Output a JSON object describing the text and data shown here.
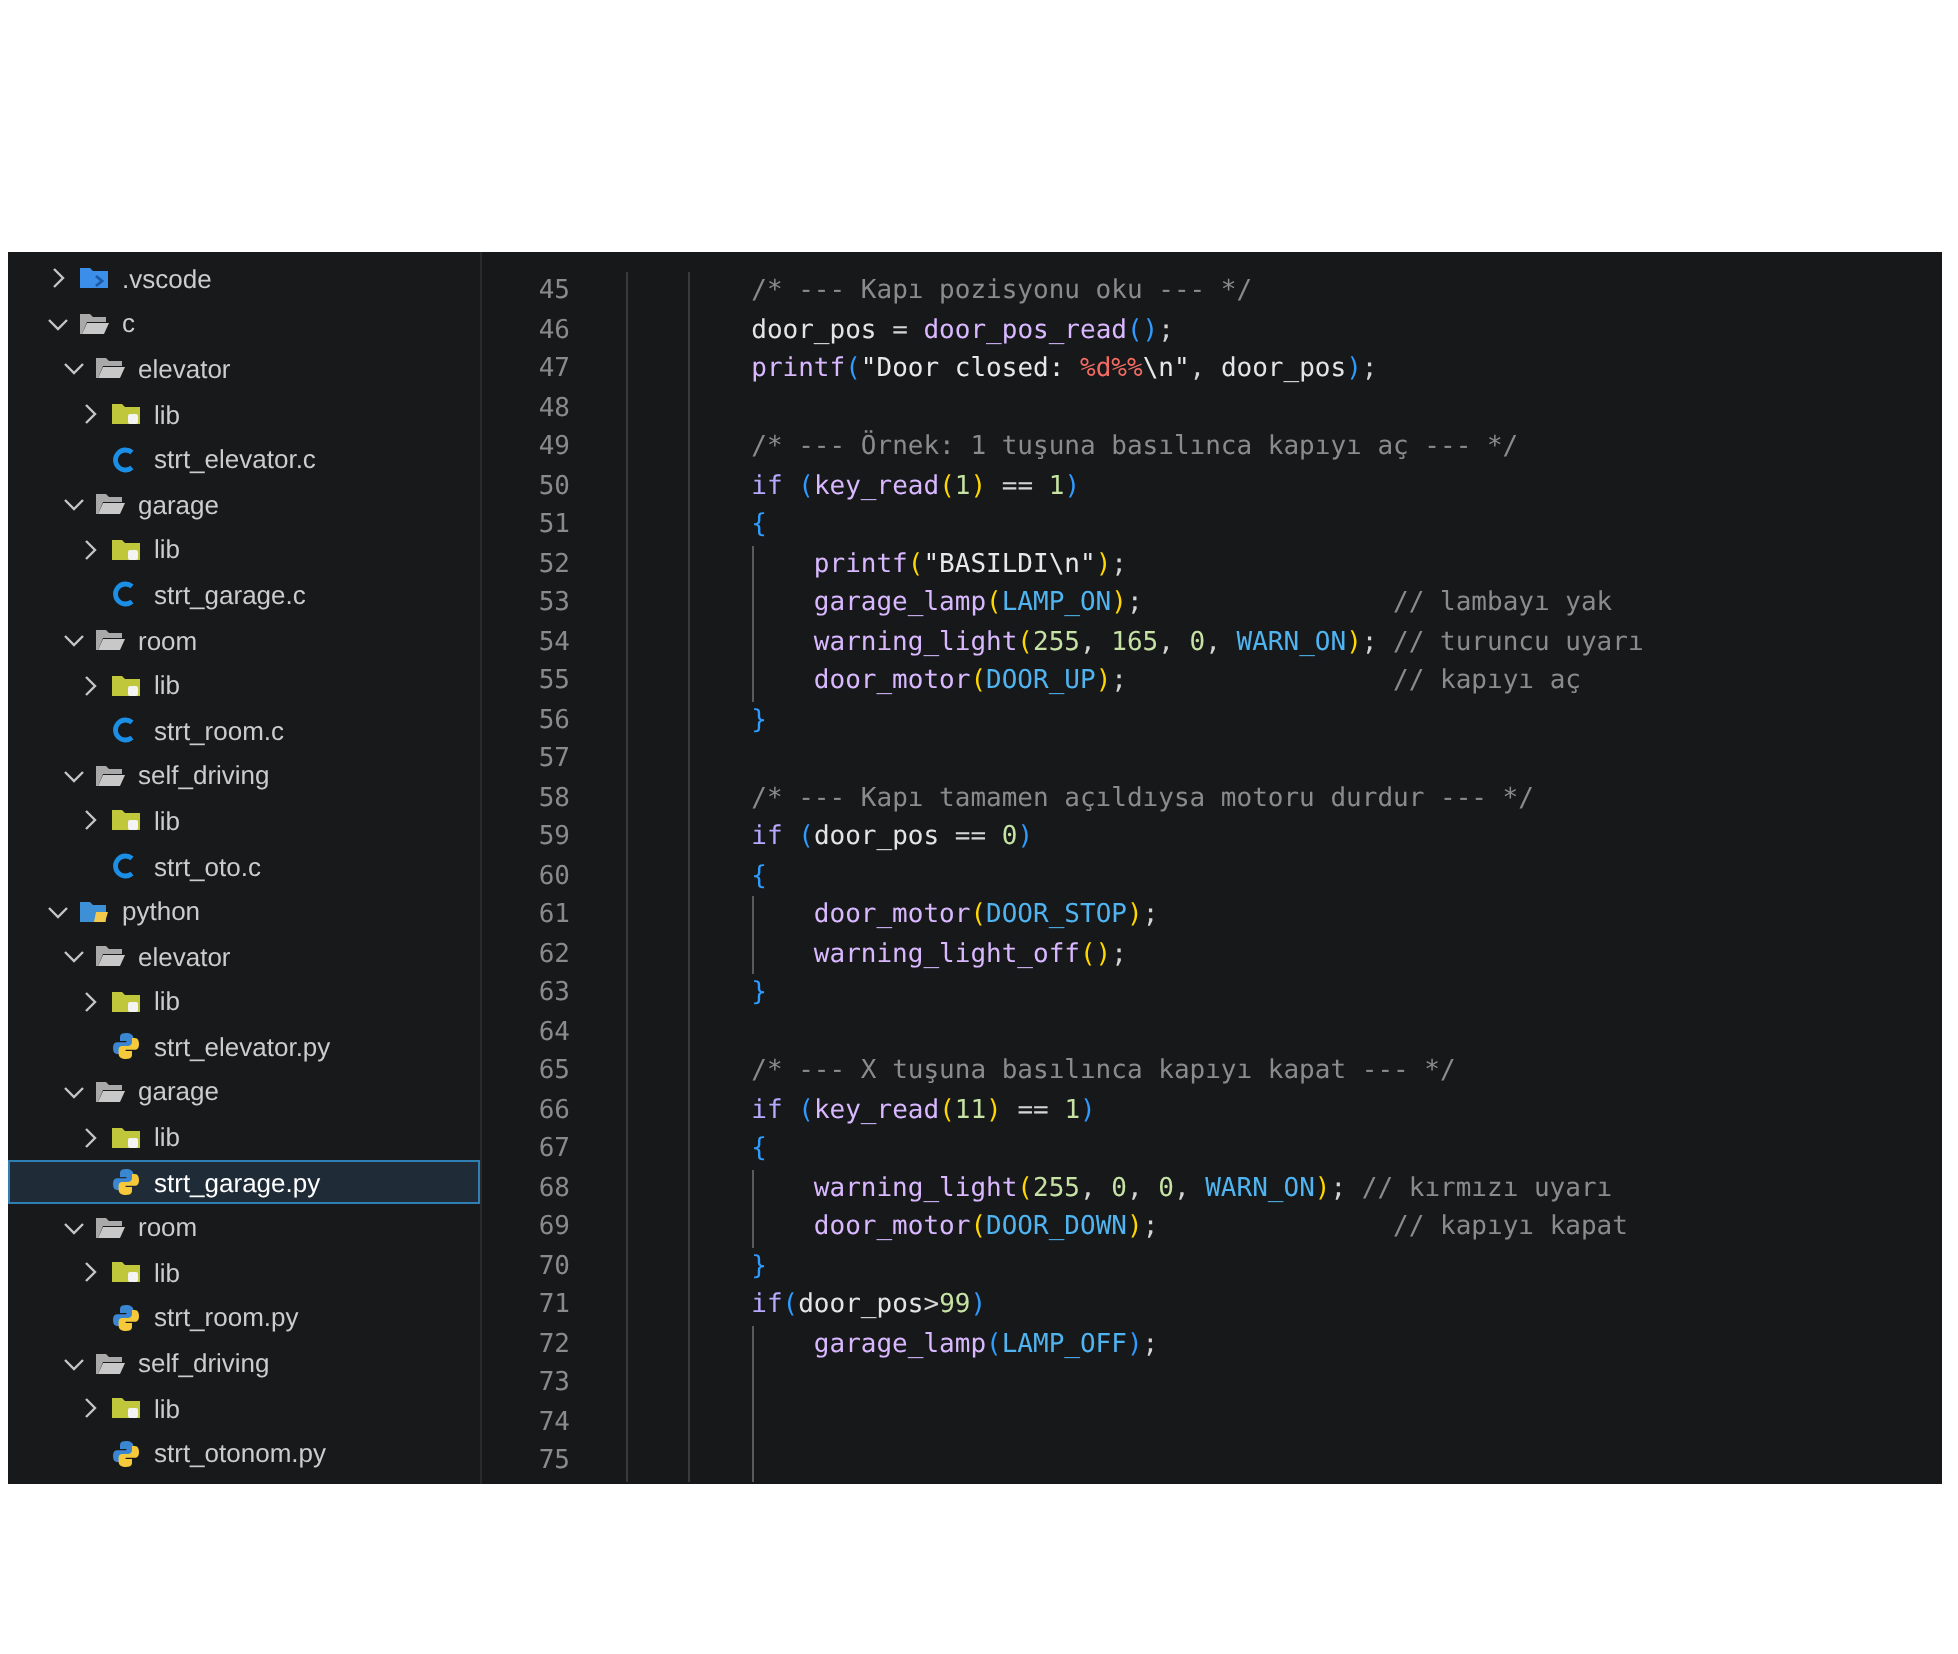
{
  "sidebar": {
    "items": [
      {
        "label": ".vscode",
        "kind": "vscode-folder",
        "expanded": false,
        "selected": false
      },
      {
        "label": "c",
        "kind": "folder",
        "expanded": true,
        "selected": false,
        "children": [
          {
            "label": "elevator",
            "kind": "folder",
            "expanded": true,
            "selected": false,
            "children": [
              {
                "label": "lib",
                "kind": "lib-folder",
                "expanded": false,
                "selected": false
              },
              {
                "label": "strt_elevator.c",
                "kind": "c-file",
                "selected": false
              }
            ]
          },
          {
            "label": "garage",
            "kind": "folder",
            "expanded": true,
            "selected": false,
            "children": [
              {
                "label": "lib",
                "kind": "lib-folder",
                "expanded": false,
                "selected": false
              },
              {
                "label": "strt_garage.c",
                "kind": "c-file",
                "selected": false
              }
            ]
          },
          {
            "label": "room",
            "kind": "folder",
            "expanded": true,
            "selected": false,
            "children": [
              {
                "label": "lib",
                "kind": "lib-folder",
                "expanded": false,
                "selected": false
              },
              {
                "label": "strt_room.c",
                "kind": "c-file",
                "selected": false
              }
            ]
          },
          {
            "label": "self_driving",
            "kind": "folder",
            "expanded": true,
            "selected": false,
            "children": [
              {
                "label": "lib",
                "kind": "lib-folder",
                "expanded": false,
                "selected": false
              },
              {
                "label": "strt_oto.c",
                "kind": "c-file",
                "selected": false
              }
            ]
          }
        ]
      },
      {
        "label": "python",
        "kind": "python-folder",
        "expanded": true,
        "selected": false,
        "children": [
          {
            "label": "elevator",
            "kind": "folder",
            "expanded": true,
            "selected": false,
            "children": [
              {
                "label": "lib",
                "kind": "lib-folder",
                "expanded": false,
                "selected": false
              },
              {
                "label": "strt_elevator.py",
                "kind": "py-file",
                "selected": false
              }
            ]
          },
          {
            "label": "garage",
            "kind": "folder",
            "expanded": true,
            "selected": false,
            "children": [
              {
                "label": "lib",
                "kind": "lib-folder",
                "expanded": false,
                "selected": false
              },
              {
                "label": "strt_garage.py",
                "kind": "py-file",
                "selected": true
              }
            ]
          },
          {
            "label": "room",
            "kind": "folder",
            "expanded": true,
            "selected": false,
            "children": [
              {
                "label": "lib",
                "kind": "lib-folder",
                "expanded": false,
                "selected": false
              },
              {
                "label": "strt_room.py",
                "kind": "py-file",
                "selected": false
              }
            ]
          },
          {
            "label": "self_driving",
            "kind": "folder",
            "expanded": true,
            "selected": false,
            "children": [
              {
                "label": "lib",
                "kind": "lib-folder",
                "expanded": false,
                "selected": false
              },
              {
                "label": "strt_otonom.py",
                "kind": "py-file",
                "selected": false
              }
            ]
          }
        ]
      }
    ]
  },
  "editor": {
    "lines": [
      {
        "number": "45",
        "tokens": [
          {
            "kind": "comment",
            "text": "        /* --- Kapı pozisyonu oku --- */"
          }
        ]
      },
      {
        "number": "46",
        "tokens": [
          {
            "kind": "var",
            "text": "        door_pos"
          },
          {
            "kind": "op",
            "text": " = "
          },
          {
            "kind": "fn",
            "text": "door_pos_read"
          },
          {
            "kind": "p1",
            "text": "()"
          },
          {
            "kind": "punc",
            "text": ";"
          }
        ]
      },
      {
        "number": "47",
        "tokens": [
          {
            "kind": "fn",
            "text": "        printf"
          },
          {
            "kind": "p1",
            "text": "("
          },
          {
            "kind": "str",
            "text": "\"Door closed: "
          },
          {
            "kind": "fmt",
            "text": "%d%%"
          },
          {
            "kind": "esc",
            "text": "\\n"
          },
          {
            "kind": "str",
            "text": "\""
          },
          {
            "kind": "punc",
            "text": ", "
          },
          {
            "kind": "var",
            "text": "door_pos"
          },
          {
            "kind": "p1",
            "text": ")"
          },
          {
            "kind": "punc",
            "text": ";"
          }
        ]
      },
      {
        "number": "48"
      },
      {
        "number": "49",
        "tokens": [
          {
            "kind": "comment",
            "text": "        /* --- Örnek: 1 tuşuna basılınca kapıyı aç --- */"
          }
        ]
      },
      {
        "number": "50",
        "tokens": [
          {
            "kind": "kw",
            "text": "        if "
          },
          {
            "kind": "p1",
            "text": "("
          },
          {
            "kind": "fn",
            "text": "key_read"
          },
          {
            "kind": "p2",
            "text": "("
          },
          {
            "kind": "num",
            "text": "1"
          },
          {
            "kind": "p2",
            "text": ")"
          },
          {
            "kind": "op",
            "text": " == "
          },
          {
            "kind": "num",
            "text": "1"
          },
          {
            "kind": "p1",
            "text": ")"
          }
        ]
      },
      {
        "number": "51",
        "tokens": [
          {
            "kind": "p1",
            "text": "        {"
          }
        ]
      },
      {
        "number": "52",
        "tokens": [
          {
            "kind": "fn",
            "text": "            printf"
          },
          {
            "kind": "p2",
            "text": "("
          },
          {
            "kind": "str",
            "text": "\"BASILDI"
          },
          {
            "kind": "esc",
            "text": "\\n"
          },
          {
            "kind": "str",
            "text": "\""
          },
          {
            "kind": "p2",
            "text": ")"
          },
          {
            "kind": "punc",
            "text": ";"
          }
        ]
      },
      {
        "number": "53",
        "tokens": [
          {
            "kind": "fn",
            "text": "            garage_lamp"
          },
          {
            "kind": "p2",
            "text": "("
          },
          {
            "kind": "const",
            "text": "LAMP_ON"
          },
          {
            "kind": "p2",
            "text": ")"
          },
          {
            "kind": "punc",
            "text": ";                "
          },
          {
            "kind": "comment",
            "text": "// lambayı yak"
          }
        ]
      },
      {
        "number": "54",
        "tokens": [
          {
            "kind": "fn",
            "text": "            warning_light"
          },
          {
            "kind": "p2",
            "text": "("
          },
          {
            "kind": "num",
            "text": "255"
          },
          {
            "kind": "punc",
            "text": ", "
          },
          {
            "kind": "num",
            "text": "165"
          },
          {
            "kind": "punc",
            "text": ", "
          },
          {
            "kind": "num",
            "text": "0"
          },
          {
            "kind": "punc",
            "text": ", "
          },
          {
            "kind": "const",
            "text": "WARN_ON"
          },
          {
            "kind": "p2",
            "text": ")"
          },
          {
            "kind": "punc",
            "text": "; "
          },
          {
            "kind": "comment",
            "text": "// turuncu uyarı"
          }
        ]
      },
      {
        "number": "55",
        "tokens": [
          {
            "kind": "fn",
            "text": "            door_motor"
          },
          {
            "kind": "p2",
            "text": "("
          },
          {
            "kind": "const",
            "text": "DOOR_UP"
          },
          {
            "kind": "p2",
            "text": ")"
          },
          {
            "kind": "punc",
            "text": ";                 "
          },
          {
            "kind": "comment",
            "text": "// kapıyı aç"
          }
        ]
      },
      {
        "number": "56",
        "tokens": [
          {
            "kind": "p1",
            "text": "        }"
          }
        ]
      },
      {
        "number": "57"
      },
      {
        "number": "58",
        "tokens": [
          {
            "kind": "comment",
            "text": "        /* --- Kapı tamamen açıldıysa motoru durdur --- */"
          }
        ]
      },
      {
        "number": "59",
        "tokens": [
          {
            "kind": "kw",
            "text": "        if "
          },
          {
            "kind": "p1",
            "text": "("
          },
          {
            "kind": "var",
            "text": "door_pos"
          },
          {
            "kind": "op",
            "text": " == "
          },
          {
            "kind": "num",
            "text": "0"
          },
          {
            "kind": "p1",
            "text": ")"
          }
        ]
      },
      {
        "number": "60",
        "tokens": [
          {
            "kind": "p1",
            "text": "        {"
          }
        ]
      },
      {
        "number": "61",
        "tokens": [
          {
            "kind": "fn",
            "text": "            door_motor"
          },
          {
            "kind": "p2",
            "text": "("
          },
          {
            "kind": "const",
            "text": "DOOR_STOP"
          },
          {
            "kind": "p2",
            "text": ")"
          },
          {
            "kind": "punc",
            "text": ";"
          }
        ]
      },
      {
        "number": "62",
        "tokens": [
          {
            "kind": "fn",
            "text": "            warning_light_off"
          },
          {
            "kind": "p2",
            "text": "()"
          },
          {
            "kind": "punc",
            "text": ";"
          }
        ]
      },
      {
        "number": "63",
        "tokens": [
          {
            "kind": "p1",
            "text": "        }"
          }
        ]
      },
      {
        "number": "64"
      },
      {
        "number": "65",
        "tokens": [
          {
            "kind": "comment",
            "text": "        /* --- X tuşuna basılınca kapıyı kapat --- */"
          }
        ]
      },
      {
        "number": "66",
        "tokens": [
          {
            "kind": "kw",
            "text": "        if "
          },
          {
            "kind": "p1",
            "text": "("
          },
          {
            "kind": "fn",
            "text": "key_read"
          },
          {
            "kind": "p2",
            "text": "("
          },
          {
            "kind": "num",
            "text": "11"
          },
          {
            "kind": "p2",
            "text": ")"
          },
          {
            "kind": "op",
            "text": " == "
          },
          {
            "kind": "num",
            "text": "1"
          },
          {
            "kind": "p1",
            "text": ")"
          }
        ]
      },
      {
        "number": "67",
        "tokens": [
          {
            "kind": "p1",
            "text": "        {"
          }
        ]
      },
      {
        "number": "68",
        "tokens": [
          {
            "kind": "fn",
            "text": "            warning_light"
          },
          {
            "kind": "p2",
            "text": "("
          },
          {
            "kind": "num",
            "text": "255"
          },
          {
            "kind": "punc",
            "text": ", "
          },
          {
            "kind": "num",
            "text": "0"
          },
          {
            "kind": "punc",
            "text": ", "
          },
          {
            "kind": "num",
            "text": "0"
          },
          {
            "kind": "punc",
            "text": ", "
          },
          {
            "kind": "const",
            "text": "WARN_ON"
          },
          {
            "kind": "p2",
            "text": ")"
          },
          {
            "kind": "punc",
            "text": "; "
          },
          {
            "kind": "comment",
            "text": "// kırmızı uyarı"
          }
        ]
      },
      {
        "number": "69",
        "tokens": [
          {
            "kind": "fn",
            "text": "            door_motor"
          },
          {
            "kind": "p2",
            "text": "("
          },
          {
            "kind": "const",
            "text": "DOOR_DOWN"
          },
          {
            "kind": "p2",
            "text": ")"
          },
          {
            "kind": "punc",
            "text": ";               "
          },
          {
            "kind": "comment",
            "text": "// kapıyı kapat"
          }
        ]
      },
      {
        "number": "70",
        "tokens": [
          {
            "kind": "p1",
            "text": "        }"
          }
        ]
      },
      {
        "number": "71",
        "tokens": [
          {
            "kind": "kw",
            "text": "        if"
          },
          {
            "kind": "p1",
            "text": "("
          },
          {
            "kind": "var",
            "text": "door_pos"
          },
          {
            "kind": "op",
            "text": ">"
          },
          {
            "kind": "num",
            "text": "99"
          },
          {
            "kind": "p1",
            "text": ")"
          }
        ]
      },
      {
        "number": "72",
        "tokens": [
          {
            "kind": "fn",
            "text": "            garage_lamp"
          },
          {
            "kind": "p1",
            "text": "("
          },
          {
            "kind": "const",
            "text": "LAMP_OFF"
          },
          {
            "kind": "p1",
            "text": ")"
          },
          {
            "kind": "punc",
            "text": ";"
          }
        ]
      },
      {
        "number": "73"
      },
      {
        "number": "74"
      },
      {
        "number": "75"
      }
    ]
  }
}
